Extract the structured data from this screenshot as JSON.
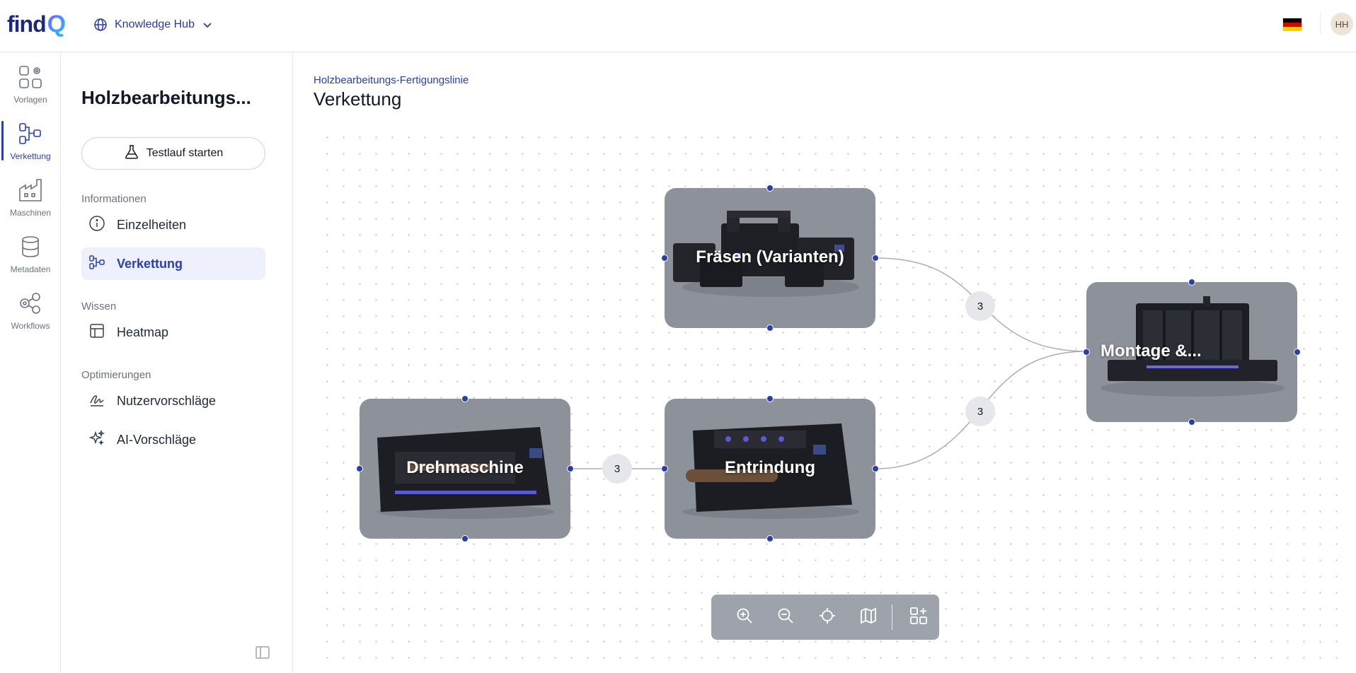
{
  "header": {
    "logo_text": "find",
    "logo_q": "Q",
    "hub_label": "Knowledge Hub",
    "avatar_initials": "HH",
    "language_flag": "de-flag-icon"
  },
  "rail": {
    "items": [
      {
        "label": "Vorlagen",
        "icon": "templates-icon"
      },
      {
        "label": "Verkettung",
        "icon": "chain-icon",
        "active": true
      },
      {
        "label": "Maschinen",
        "icon": "factory-icon"
      },
      {
        "label": "Metadaten",
        "icon": "database-icon"
      },
      {
        "label": "Workflows",
        "icon": "workflows-icon"
      }
    ]
  },
  "panel": {
    "title": "Holzbearbeitungs...",
    "test_button": "Testlauf starten",
    "sections": [
      {
        "label": "Informationen",
        "items": [
          {
            "label": "Einzelheiten",
            "icon": "info-icon"
          },
          {
            "label": "Verkettung",
            "icon": "chain-icon",
            "active": true
          }
        ]
      },
      {
        "label": "Wissen",
        "items": [
          {
            "label": "Heatmap",
            "icon": "table-icon"
          }
        ]
      },
      {
        "label": "Optimierungen",
        "items": [
          {
            "label": "Nutzervorschläge",
            "icon": "signature-icon"
          },
          {
            "label": "AI-Vorschläge",
            "icon": "sparkles-icon"
          }
        ]
      }
    ]
  },
  "main": {
    "breadcrumb": "Holzbearbeitungs-Fertigungslinie",
    "title": "Verkettung"
  },
  "flow": {
    "nodes": {
      "fraesen": "Fräsen (Varianten)",
      "montage": "Montage &...",
      "drehmaschine": "Drehmaschine",
      "entrindung": "Entrindung"
    },
    "edges": {
      "fraesen_montage": "3",
      "entrindung_montage": "3",
      "drehmaschine_entrindung": "3"
    }
  },
  "toolbar": {
    "buttons": [
      "zoom-in-icon",
      "zoom-out-icon",
      "fit-view-icon",
      "map-icon",
      "add-node-icon"
    ]
  },
  "colors": {
    "accent": "#2a3fa7",
    "node_bg": "#8d9199",
    "edge_badge": "#e5e7eb"
  }
}
